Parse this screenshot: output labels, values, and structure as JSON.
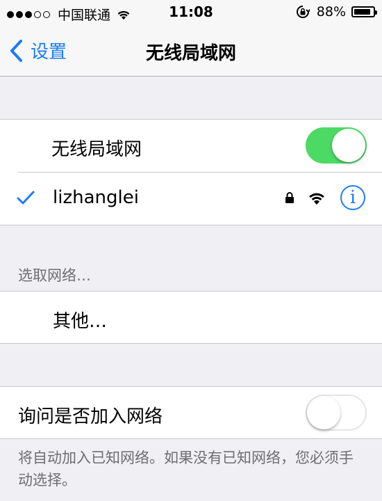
{
  "status_bar": {
    "carrier": "中国联通",
    "time": "11:08",
    "battery_percent": "88%",
    "signal_bars_filled": 3,
    "signal_bars_total": 5,
    "battery_level": 0.88
  },
  "nav": {
    "back_label": "设置",
    "title": "无线局域网"
  },
  "wifi_toggle": {
    "label": "无线局域网",
    "on": true
  },
  "connected_network": {
    "name": "lizhanglei",
    "secured": true,
    "icons": [
      "checkmark-icon",
      "lock-icon",
      "wifi-signal-icon",
      "info-icon"
    ]
  },
  "choose_network": {
    "header": "选取网络…",
    "other_label": "其他…"
  },
  "ask_to_join": {
    "label": "询问是否加入网络",
    "on": false,
    "footer": "将自动加入已知网络。如果没有已知网络，您必须手动选择。"
  },
  "colors": {
    "accent": "#1a7cf5",
    "switch_on": "#4cd964",
    "background": "#efeff4"
  }
}
